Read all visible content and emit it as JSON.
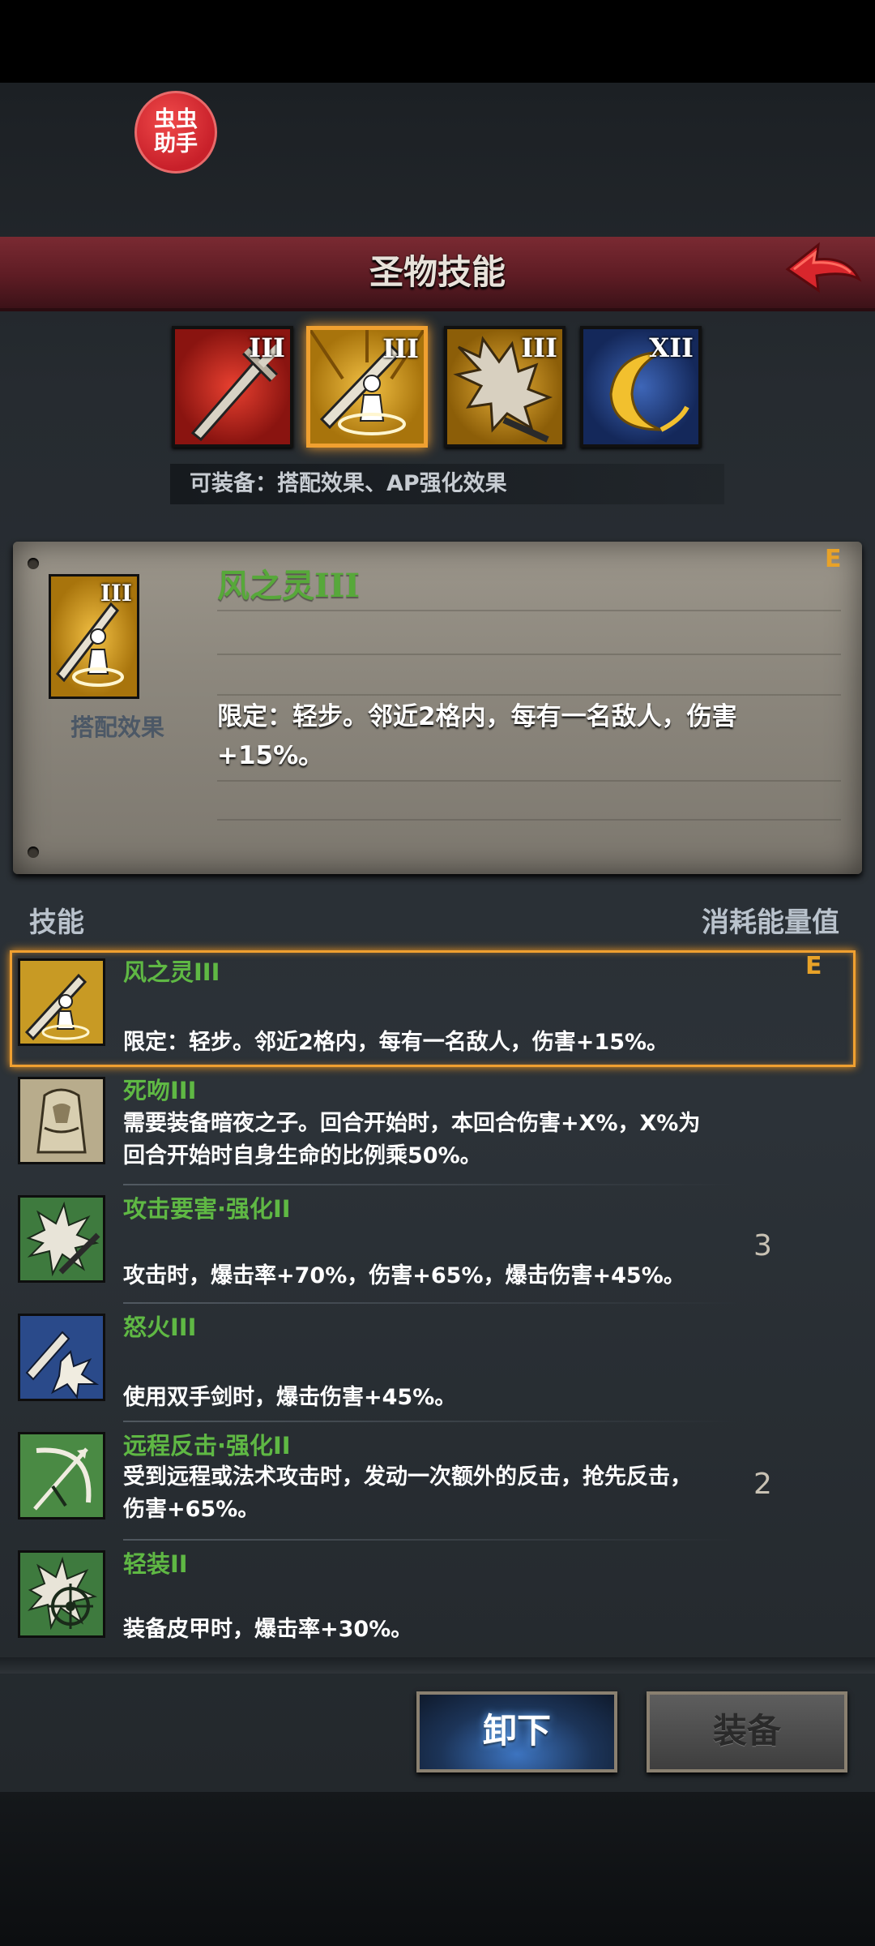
{
  "helper_badge": "虫虫\n助手",
  "header": {
    "title": "圣物技能"
  },
  "relics": [
    {
      "rank": "III",
      "icon": "red-sword-icon"
    },
    {
      "rank": "III",
      "icon": "gold-sword-figure-icon",
      "selected": true
    },
    {
      "rank": "III",
      "icon": "gold-thorn-blade-icon"
    },
    {
      "rank": "XII",
      "icon": "blue-crescent-moon-icon"
    }
  ],
  "equip_note": "可装备：搭配效果、AP强化效果",
  "detail": {
    "name": "风之灵III",
    "rank": "E",
    "caption": "搭配效果",
    "icon_rank": "III",
    "description": "限定：轻步。邻近2格内，每有一名敌人，伤害+15%。"
  },
  "list_header": {
    "skill": "技能",
    "cost": "消耗能量值"
  },
  "skills": [
    {
      "name": "风之灵III",
      "desc": "限定：轻步。邻近2格内，每有一名敌人，伤害+15%。",
      "cost": "",
      "rank": "E"
    },
    {
      "name": "死吻III",
      "desc": "需要装备暗夜之子。回合开始时，本回合伤害+X%，X%为回合开始时自身生命的比例乘50%。",
      "cost": "",
      "rank": ""
    },
    {
      "name": "攻击要害·强化II",
      "desc": "攻击时，爆击率+70%，伤害+65%，爆击伤害+45%。",
      "cost": "3",
      "rank": ""
    },
    {
      "name": "怒火III",
      "desc": "使用双手剑时，爆击伤害+45%。",
      "cost": "",
      "rank": ""
    },
    {
      "name": "远程反击·强化II",
      "desc": "受到远程或法术攻击时，发动一次额外的反击，抢先反击，伤害+65%。",
      "cost": "2",
      "rank": ""
    },
    {
      "name": "轻装II",
      "desc": "装备皮甲时，爆击率+30%。",
      "cost": "",
      "rank": ""
    }
  ],
  "buttons": {
    "unequip": "卸下",
    "equip": "装备"
  },
  "colors": {
    "skill_name": "#5fb844",
    "rank": "#e8a228",
    "header": "#6a2028",
    "select_glow": "#f0a030"
  }
}
